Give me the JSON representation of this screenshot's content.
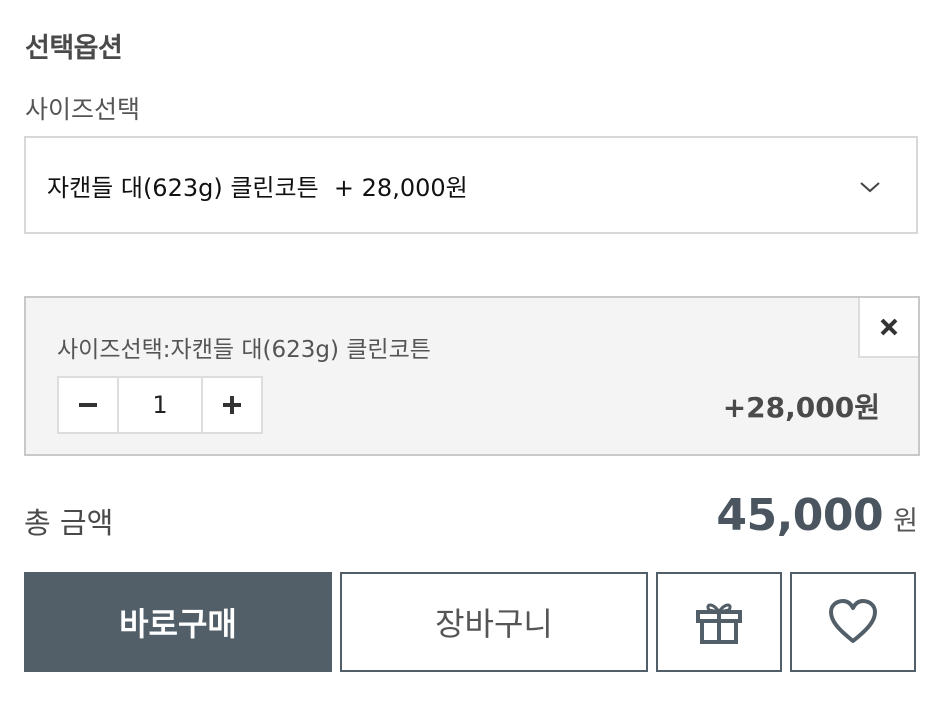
{
  "options": {
    "section_title": "선택옵션",
    "size_label": "사이즈선택",
    "select": {
      "selected_value": "자캔들 대(623g) 클린코튼  + 28,000원",
      "chevron_icon": "chevron-down-icon"
    }
  },
  "selected_item": {
    "name": "사이즈선택:자캔들 대(623g) 클린코튼",
    "remove_icon": "close-icon",
    "quantity": {
      "minus_icon": "minus-icon",
      "value": "1",
      "plus_icon": "plus-icon"
    },
    "price": "+28,000원"
  },
  "total": {
    "label": "총 금액",
    "value": "45,000",
    "unit": "원"
  },
  "actions": {
    "buy_label": "바로구매",
    "cart_label": "장바구니",
    "gift_icon": "gift-icon",
    "wish_icon": "heart-icon"
  },
  "colors": {
    "primary_button": "#525f68",
    "total_value": "#4a5560",
    "panel_background": "#f4f4f4"
  }
}
